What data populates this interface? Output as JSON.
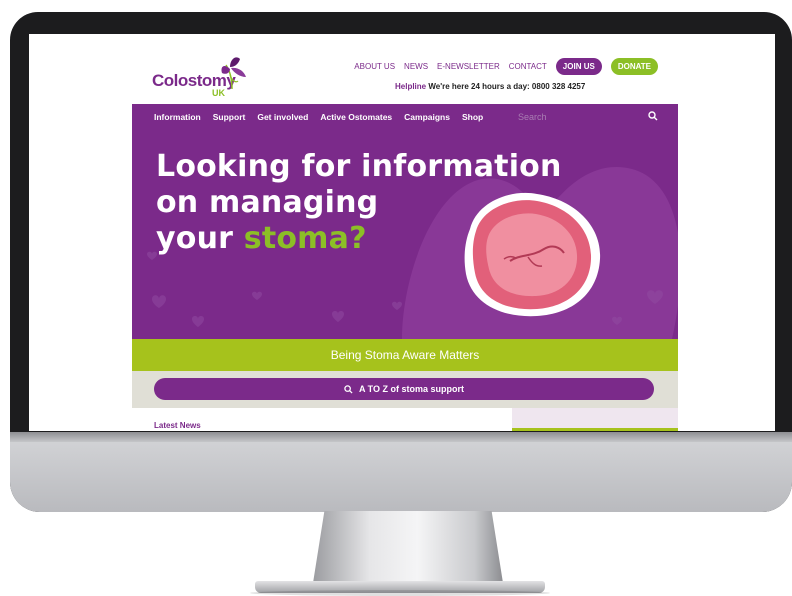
{
  "site": {
    "logo": {
      "name": "Colostomy",
      "sub": "UK"
    },
    "top_nav": [
      "ABOUT US",
      "NEWS",
      "E-NEWSLETTER",
      "CONTACT"
    ],
    "join_label": "JOIN US",
    "donate_label": "DONATE",
    "helpline_label": "Helpline",
    "helpline_text": "We're here 24 hours a day: 0800 328 4257"
  },
  "main_nav": {
    "items": [
      "Information",
      "Support",
      "Get involved",
      "Active Ostomates",
      "Campaigns",
      "Shop"
    ],
    "search_placeholder": "Search"
  },
  "hero": {
    "line1": "Looking for information",
    "line2": "on managing",
    "line3_prefix": "your ",
    "line3_accent": "stoma?"
  },
  "band": {
    "text": "Being Stoma Aware Matters"
  },
  "az_button": {
    "label": "A TO Z of stoma support"
  },
  "news": {
    "heading": "Latest News"
  },
  "colors": {
    "brand_purple": "#7b2a8a",
    "brand_green": "#8cbf26",
    "band_green": "#a6c21c"
  },
  "icons": [
    "iris-logo-icon",
    "search-icon",
    "stoma-illustration"
  ]
}
